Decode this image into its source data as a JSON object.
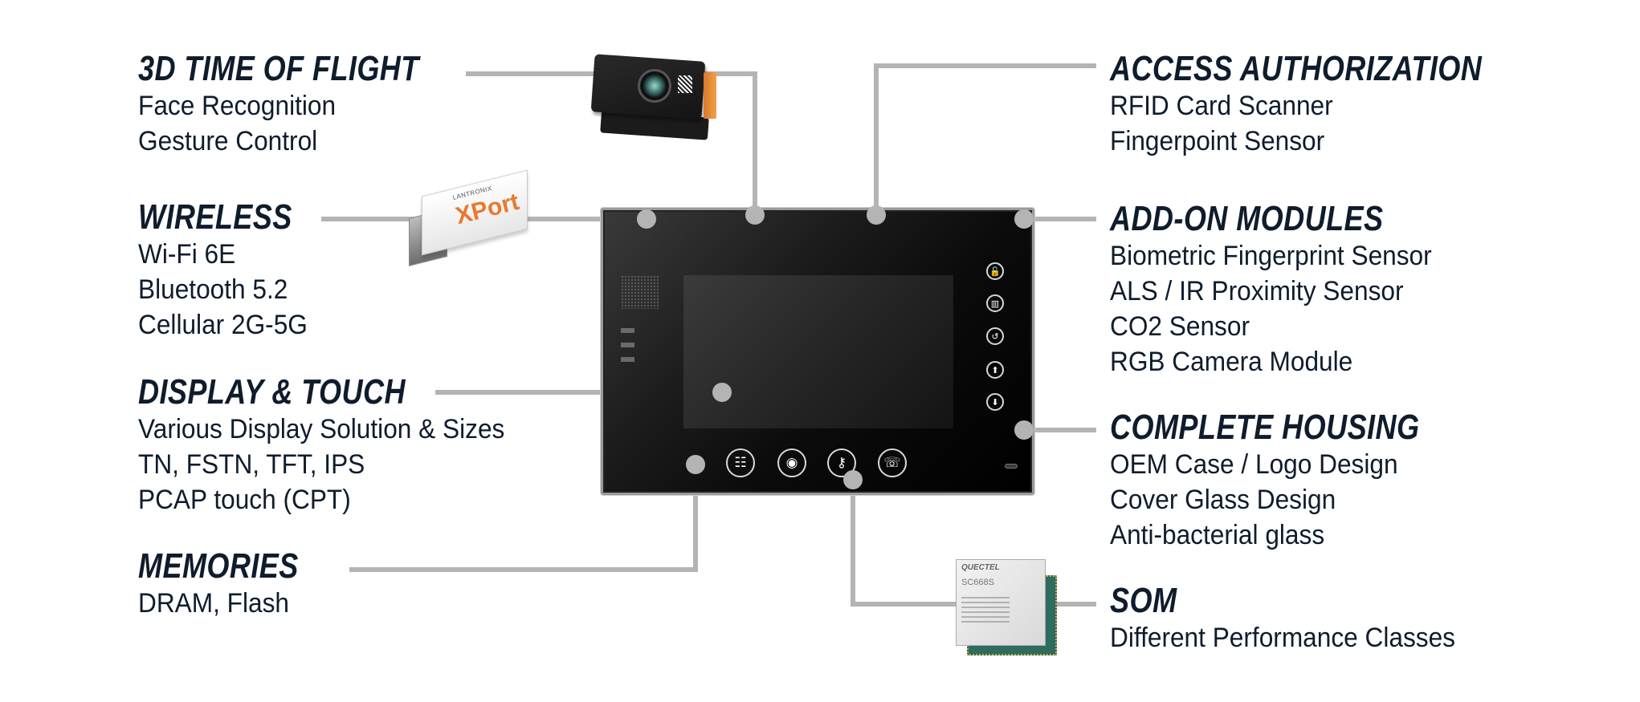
{
  "colors": {
    "heading": "#0f1c2c",
    "body_text": "#0f1c2c",
    "connector": "#b4b4b4",
    "device_bezel": "#000000",
    "background": "#ffffff"
  },
  "features_left": [
    {
      "heading": "3D TIME OF FLIGHT",
      "items": [
        "Face Recognition",
        "Gesture Control"
      ]
    },
    {
      "heading": "WIRELESS",
      "items": [
        "Wi-Fi 6E",
        "Bluetooth 5.2",
        "Cellular 2G-5G"
      ]
    },
    {
      "heading": "DISPLAY & TOUCH",
      "items": [
        "Various Display Solution & Sizes",
        "TN, FSTN, TFT, IPS",
        "PCAP touch (CPT)"
      ]
    },
    {
      "heading": "MEMORIES",
      "items": [
        "DRAM, Flash"
      ]
    }
  ],
  "features_right": [
    {
      "heading": "ACCESS AUTHORIZATION",
      "items": [
        "RFID Card Scanner",
        "Fingerpoint Sensor"
      ]
    },
    {
      "heading": "ADD-ON MODULES",
      "items": [
        "Biometric Fingerprint Sensor",
        "ALS / IR Proximity Sensor",
        "CO2 Sensor",
        "RGB Camera Module"
      ]
    },
    {
      "heading": "COMPLETE HOUSING",
      "items": [
        "OEM Case / Logo Design",
        "Cover Glass Design",
        "Anti-bacterial glass"
      ]
    },
    {
      "heading": "SOM",
      "items": [
        "Different Performance Classes"
      ]
    }
  ],
  "modules": {
    "xport": {
      "brand": "LANTRONIX",
      "logo": "XPort"
    },
    "som": {
      "maker": "QUECTEL",
      "model": "SC668S"
    }
  },
  "device": {
    "side_buttons": [
      {
        "icon": "unlock-icon",
        "glyph": "🔓"
      },
      {
        "icon": "contacts-book-icon",
        "glyph": "▥"
      },
      {
        "icon": "hand-return-icon",
        "glyph": "↺"
      },
      {
        "icon": "arrow-up-icon",
        "glyph": "⬆"
      },
      {
        "icon": "arrow-down-icon",
        "glyph": "⬇"
      }
    ],
    "bottom_buttons": [
      {
        "icon": "intercom-icon",
        "glyph": "☷"
      },
      {
        "icon": "record-icon",
        "glyph": "◉"
      },
      {
        "icon": "key-icon",
        "glyph": "⚷"
      },
      {
        "icon": "talk-icon",
        "glyph": "☏"
      }
    ]
  }
}
